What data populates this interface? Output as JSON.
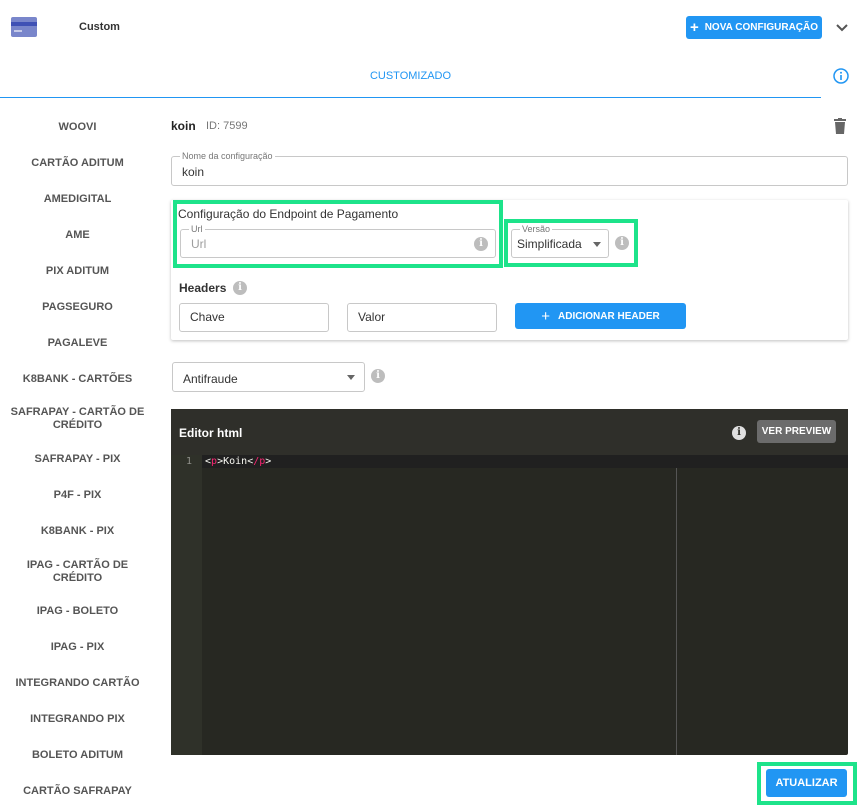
{
  "header": {
    "title": "Custom",
    "new_button_label": "NOVA CONFIGURAÇÃO",
    "icon": "credit-card-icon"
  },
  "tabs": [
    {
      "label": "CUSTOMIZADO",
      "active": true
    }
  ],
  "sidebar": {
    "items": [
      {
        "label": "WOOVI"
      },
      {
        "label": "CARTÃO ADITUM"
      },
      {
        "label": "AMEDIGITAL"
      },
      {
        "label": "AME"
      },
      {
        "label": "PIX ADITUM"
      },
      {
        "label": "PAGSEGURO"
      },
      {
        "label": "PAGALEVE"
      },
      {
        "label": "K8BANK - CARTÕES"
      },
      {
        "label": "SAFRAPAY - CARTÃO DE CRÉDITO"
      },
      {
        "label": "SAFRAPAY - PIX"
      },
      {
        "label": "P4F - PIX"
      },
      {
        "label": "K8BANK - PIX"
      },
      {
        "label": "IPAG - CARTÃO DE CRÉDITO"
      },
      {
        "label": "IPAG - BOLETO"
      },
      {
        "label": "IPAG - PIX"
      },
      {
        "label": "INTEGRANDO CARTÃO"
      },
      {
        "label": "INTEGRANDO PIX"
      },
      {
        "label": "BOLETO ADITUM"
      },
      {
        "label": "CARTÃO SAFRAPAY"
      }
    ]
  },
  "config": {
    "name": "koin",
    "id_label": "ID: 7599",
    "name_field": {
      "label": "Nome da configuração",
      "value": "koin"
    }
  },
  "endpoint": {
    "title": "Configuração do Endpoint de Pagamento",
    "url_label": "Url",
    "url_placeholder": "Url",
    "version_label": "Versão",
    "version_value": "Simplificada"
  },
  "headers": {
    "title": "Headers",
    "key_placeholder": "Chave",
    "value_placeholder": "Valor",
    "add_button": "ADICIONAR HEADER"
  },
  "antifraude": {
    "value": "Antifraude"
  },
  "editor": {
    "title": "Editor html",
    "preview_button": "VER PREVIEW",
    "line_number": "1",
    "code": {
      "open_tag": "p",
      "text": "Koin",
      "close_tag": "/p"
    }
  },
  "footer": {
    "update_button": "ATUALIZAR"
  },
  "colors": {
    "accent": "#2196f3",
    "highlight": "#1de38a",
    "editor_bg": "#272822",
    "tag": "#f92672"
  }
}
